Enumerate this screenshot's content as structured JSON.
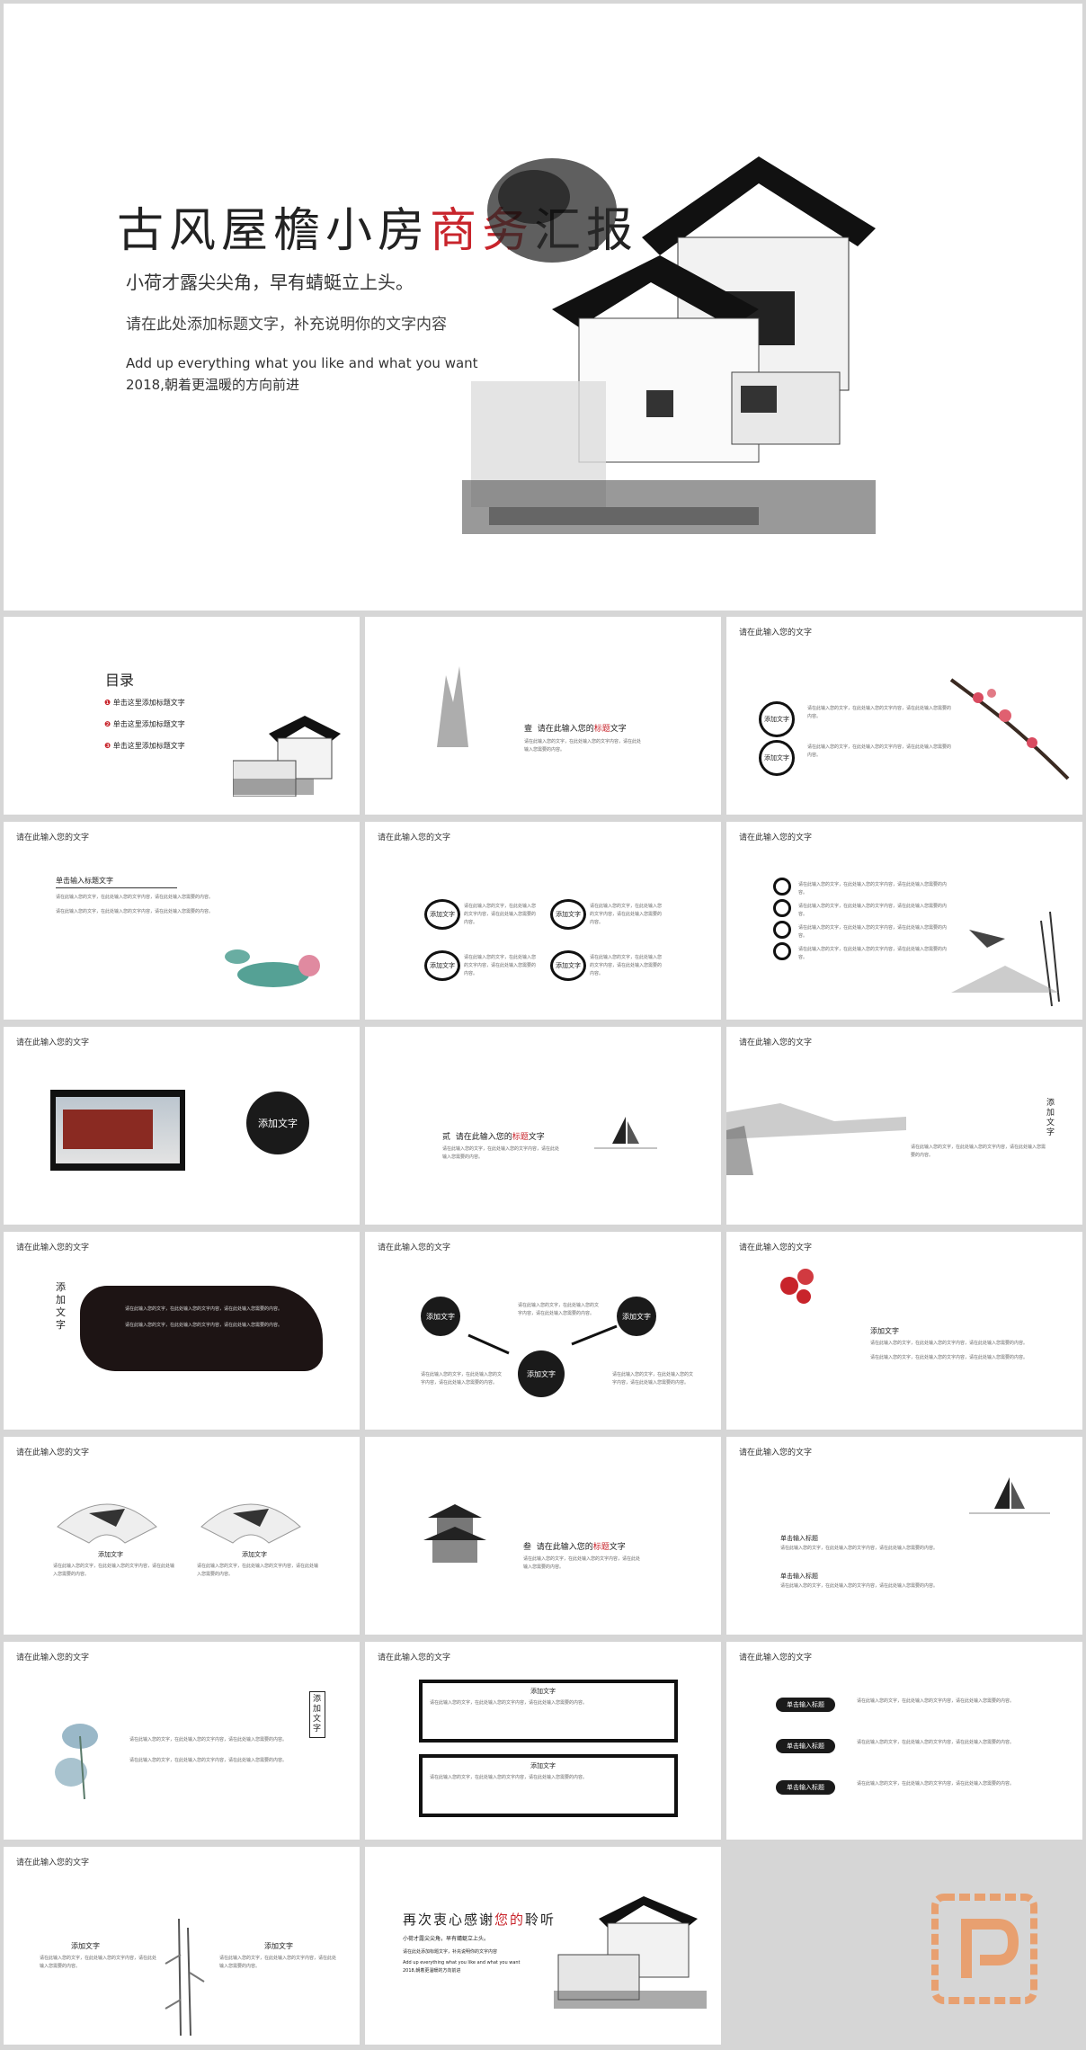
{
  "hero": {
    "title_main": "古风屋檐小房",
    "title_accent": "商务",
    "title_end": "汇报",
    "subtitle": "小荷才露尖尖角，早有蜻蜓立上头。",
    "desc": "请在此处添加标题文字，补充说明你的文字内容",
    "en_line": "Add up everything what you like and what you want",
    "year_line": "2018,朝着更温暖的方向前进"
  },
  "header_text": "请在此输入您的文字",
  "toc": {
    "title": "目录",
    "items": [
      "单击这里添加标题文字",
      "单击这里添加标题文字",
      "单击这里添加标题文字"
    ]
  },
  "section1": {
    "prefix": "壹",
    "text": "请在此输入您的",
    "accent": "标题",
    "suffix": "文字"
  },
  "section2": {
    "prefix": "贰",
    "text": "请在此输入您的",
    "accent": "标题",
    "suffix": "文字"
  },
  "section3": {
    "prefix": "叁",
    "text": "请在此输入您的",
    "accent": "标题",
    "suffix": "文字"
  },
  "add_text": "添加文字",
  "click_title": "单击输入标题文字",
  "click_title_short": "单击输入标题",
  "body_text": "请在此输入您的文字，在此处输入您的文字内容，请在此处输入您需要的内容。",
  "closing": {
    "title_main": "再次衷心感谢",
    "title_accent": "您的",
    "title_end": "聆听",
    "subtitle": "小荷才露尖尖角，早有蜻蜓立上头。",
    "desc": "请在此处添加标题文字，补充说明你的文字内容",
    "en_line": "Add up everything what you like and what you want",
    "year_line": "2018,朝着更温暖的方向前进"
  },
  "colors": {
    "accent": "#c8242b",
    "ink": "#1a1a1a",
    "background": "#d6d6d6",
    "watermark": "#e8a070"
  }
}
